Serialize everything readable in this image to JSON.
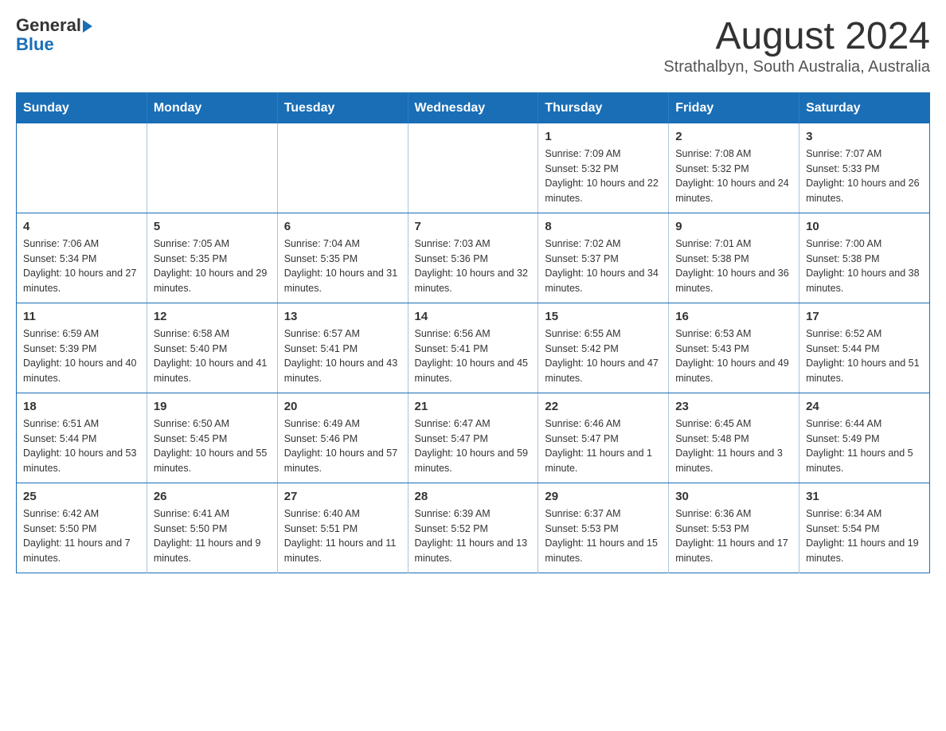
{
  "logo": {
    "general": "General",
    "blue": "Blue"
  },
  "title": "August 2024",
  "subtitle": "Strathalbyn, South Australia, Australia",
  "days_of_week": [
    "Sunday",
    "Monday",
    "Tuesday",
    "Wednesday",
    "Thursday",
    "Friday",
    "Saturday"
  ],
  "weeks": [
    [
      {
        "day": "",
        "info": ""
      },
      {
        "day": "",
        "info": ""
      },
      {
        "day": "",
        "info": ""
      },
      {
        "day": "",
        "info": ""
      },
      {
        "day": "1",
        "info": "Sunrise: 7:09 AM\nSunset: 5:32 PM\nDaylight: 10 hours and 22 minutes."
      },
      {
        "day": "2",
        "info": "Sunrise: 7:08 AM\nSunset: 5:32 PM\nDaylight: 10 hours and 24 minutes."
      },
      {
        "day": "3",
        "info": "Sunrise: 7:07 AM\nSunset: 5:33 PM\nDaylight: 10 hours and 26 minutes."
      }
    ],
    [
      {
        "day": "4",
        "info": "Sunrise: 7:06 AM\nSunset: 5:34 PM\nDaylight: 10 hours and 27 minutes."
      },
      {
        "day": "5",
        "info": "Sunrise: 7:05 AM\nSunset: 5:35 PM\nDaylight: 10 hours and 29 minutes."
      },
      {
        "day": "6",
        "info": "Sunrise: 7:04 AM\nSunset: 5:35 PM\nDaylight: 10 hours and 31 minutes."
      },
      {
        "day": "7",
        "info": "Sunrise: 7:03 AM\nSunset: 5:36 PM\nDaylight: 10 hours and 32 minutes."
      },
      {
        "day": "8",
        "info": "Sunrise: 7:02 AM\nSunset: 5:37 PM\nDaylight: 10 hours and 34 minutes."
      },
      {
        "day": "9",
        "info": "Sunrise: 7:01 AM\nSunset: 5:38 PM\nDaylight: 10 hours and 36 minutes."
      },
      {
        "day": "10",
        "info": "Sunrise: 7:00 AM\nSunset: 5:38 PM\nDaylight: 10 hours and 38 minutes."
      }
    ],
    [
      {
        "day": "11",
        "info": "Sunrise: 6:59 AM\nSunset: 5:39 PM\nDaylight: 10 hours and 40 minutes."
      },
      {
        "day": "12",
        "info": "Sunrise: 6:58 AM\nSunset: 5:40 PM\nDaylight: 10 hours and 41 minutes."
      },
      {
        "day": "13",
        "info": "Sunrise: 6:57 AM\nSunset: 5:41 PM\nDaylight: 10 hours and 43 minutes."
      },
      {
        "day": "14",
        "info": "Sunrise: 6:56 AM\nSunset: 5:41 PM\nDaylight: 10 hours and 45 minutes."
      },
      {
        "day": "15",
        "info": "Sunrise: 6:55 AM\nSunset: 5:42 PM\nDaylight: 10 hours and 47 minutes."
      },
      {
        "day": "16",
        "info": "Sunrise: 6:53 AM\nSunset: 5:43 PM\nDaylight: 10 hours and 49 minutes."
      },
      {
        "day": "17",
        "info": "Sunrise: 6:52 AM\nSunset: 5:44 PM\nDaylight: 10 hours and 51 minutes."
      }
    ],
    [
      {
        "day": "18",
        "info": "Sunrise: 6:51 AM\nSunset: 5:44 PM\nDaylight: 10 hours and 53 minutes."
      },
      {
        "day": "19",
        "info": "Sunrise: 6:50 AM\nSunset: 5:45 PM\nDaylight: 10 hours and 55 minutes."
      },
      {
        "day": "20",
        "info": "Sunrise: 6:49 AM\nSunset: 5:46 PM\nDaylight: 10 hours and 57 minutes."
      },
      {
        "day": "21",
        "info": "Sunrise: 6:47 AM\nSunset: 5:47 PM\nDaylight: 10 hours and 59 minutes."
      },
      {
        "day": "22",
        "info": "Sunrise: 6:46 AM\nSunset: 5:47 PM\nDaylight: 11 hours and 1 minute."
      },
      {
        "day": "23",
        "info": "Sunrise: 6:45 AM\nSunset: 5:48 PM\nDaylight: 11 hours and 3 minutes."
      },
      {
        "day": "24",
        "info": "Sunrise: 6:44 AM\nSunset: 5:49 PM\nDaylight: 11 hours and 5 minutes."
      }
    ],
    [
      {
        "day": "25",
        "info": "Sunrise: 6:42 AM\nSunset: 5:50 PM\nDaylight: 11 hours and 7 minutes."
      },
      {
        "day": "26",
        "info": "Sunrise: 6:41 AM\nSunset: 5:50 PM\nDaylight: 11 hours and 9 minutes."
      },
      {
        "day": "27",
        "info": "Sunrise: 6:40 AM\nSunset: 5:51 PM\nDaylight: 11 hours and 11 minutes."
      },
      {
        "day": "28",
        "info": "Sunrise: 6:39 AM\nSunset: 5:52 PM\nDaylight: 11 hours and 13 minutes."
      },
      {
        "day": "29",
        "info": "Sunrise: 6:37 AM\nSunset: 5:53 PM\nDaylight: 11 hours and 15 minutes."
      },
      {
        "day": "30",
        "info": "Sunrise: 6:36 AM\nSunset: 5:53 PM\nDaylight: 11 hours and 17 minutes."
      },
      {
        "day": "31",
        "info": "Sunrise: 6:34 AM\nSunset: 5:54 PM\nDaylight: 11 hours and 19 minutes."
      }
    ]
  ]
}
